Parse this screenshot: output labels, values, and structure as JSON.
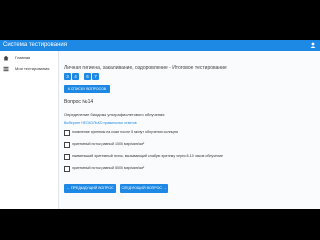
{
  "header": {
    "title": "Система тестирования"
  },
  "sidebar": {
    "items": [
      {
        "label": "Главная",
        "icon": "home-icon"
      },
      {
        "label": "Мои тестирования",
        "icon": "list-icon"
      }
    ]
  },
  "test": {
    "title": "Личная гигиена, закаливание, оздоровление - Итоговое тестирование",
    "question_numbers": [
      "3",
      "4",
      "6",
      "7"
    ],
    "question_list_button": "К СПИСКУ ВОПРОСОВ",
    "question_label": "Вопрос №14",
    "question_text": "Определение биодозы ультрафиолетового облучения",
    "hint": "Выберите НЕСКОЛЬКО правильных ответов",
    "options": [
      "появление эритемы на коже после 5 минут облучения солнцем",
      "эритемный поток равный 1000 мэр/мин/см²",
      "наименьший эритемный поток, вызывающий слабую эритему через 8-10 часов облучение",
      "эритемный поток равный 5000 мэр/мин/см²"
    ],
    "prev_button": "← ПРЕДЫДУЩИЙ ВОПРОС",
    "next_button": "СЛЕДУЮЩИЙ ВОПРОС →"
  },
  "colors": {
    "accent": "#1e88e5",
    "background": "#fafbfc"
  }
}
